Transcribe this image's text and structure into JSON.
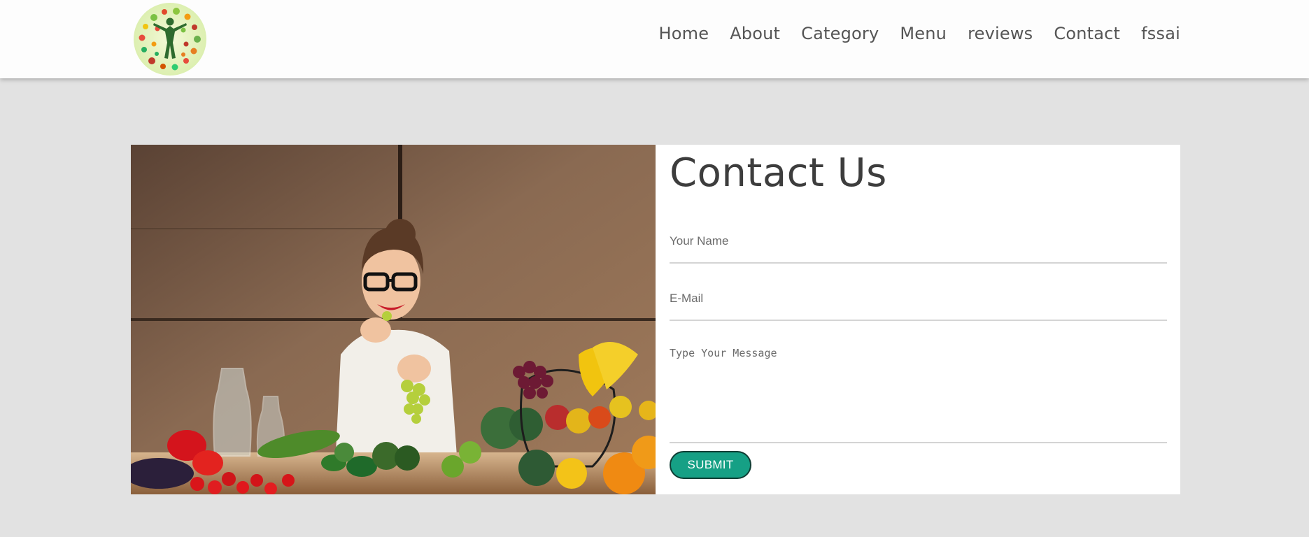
{
  "header": {
    "logo_name": "green-produce-figure-logo",
    "nav": [
      {
        "label": "Home"
      },
      {
        "label": "About"
      },
      {
        "label": "Category"
      },
      {
        "label": "Menu"
      },
      {
        "label": "reviews"
      },
      {
        "label": "Contact"
      },
      {
        "label": "fssai"
      }
    ]
  },
  "contact": {
    "title": "Contact Us",
    "name_placeholder": "Your Name",
    "email_placeholder": "E-Mail",
    "message_placeholder": "Type Your Message",
    "submit_label": "SUBMIT"
  },
  "colors": {
    "page_background": "#e2e2e2",
    "header_background": "#fdfdfd",
    "submit_button": "#16a085",
    "nav_text": "#555555"
  }
}
